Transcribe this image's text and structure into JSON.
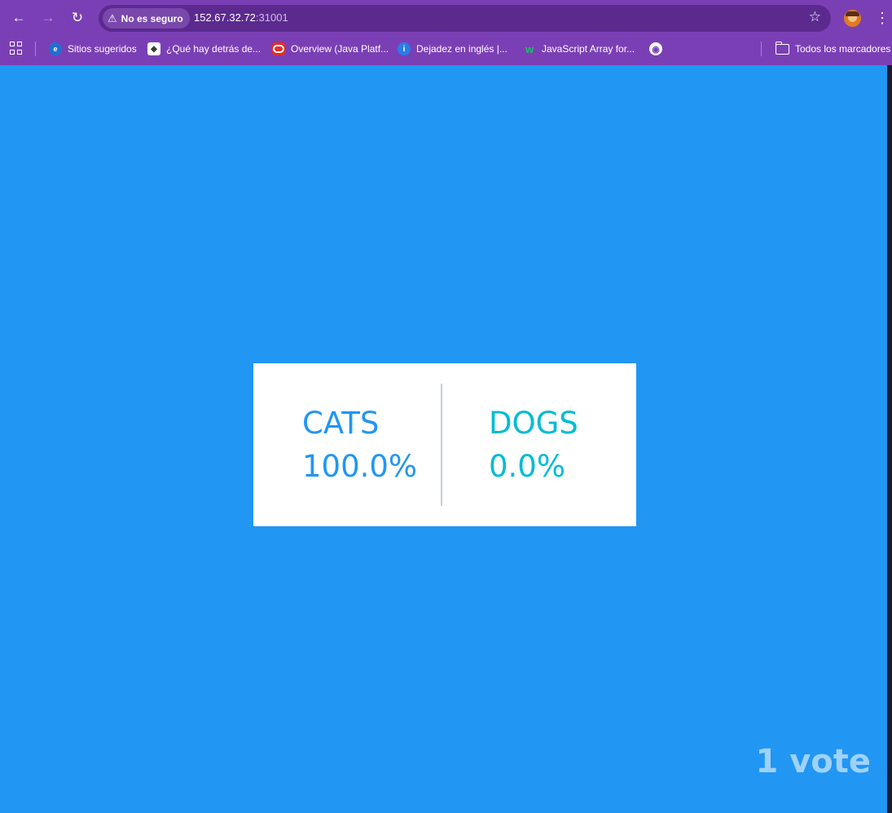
{
  "browser": {
    "security_label": "No es seguro",
    "url_host": "152.67.32.72",
    "url_port": ":31001",
    "bookmarks": [
      {
        "label": "Sitios sugeridos",
        "icon": "edge-icon"
      },
      {
        "label": "¿Qué hay detrás de...",
        "icon": "site-icon"
      },
      {
        "label": "Overview (Java Platf...",
        "icon": "oracle-icon"
      },
      {
        "label": "Dejadez en inglés |...",
        "icon": "info-icon"
      },
      {
        "label": "JavaScript Array for...",
        "icon": "w3schools-icon"
      },
      {
        "label": "",
        "icon": "globe-icon"
      }
    ],
    "all_bookmarks_label": "Todos los marcadores"
  },
  "results": {
    "option_a": {
      "label": "CATS",
      "percent": "100.0%"
    },
    "option_b": {
      "label": "DOGS",
      "percent": "0.0%"
    },
    "vote_count": "1 vote"
  },
  "colors": {
    "page_background": "#2196f3",
    "chrome": "#7b3fb5",
    "cats": "#2196f3",
    "dogs": "#00bcd4",
    "vote_count": "#9fd2fb"
  }
}
